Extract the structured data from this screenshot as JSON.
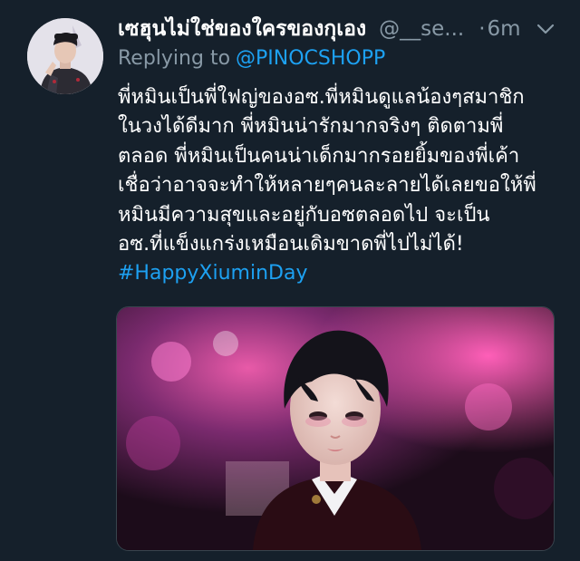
{
  "tweet": {
    "display_name": "เซฮุนไม่ใช่ของใครของกุเอง",
    "handle": "@__se...",
    "separator": "·",
    "time": "6m",
    "replying_prefix": "Replying to",
    "replying_to": "@PINOCSHOPP",
    "body_lines": [
      "พี่หมินเป็นพี่ใฟญ่ของอซ.พี่หมินดูแลน้องๆสมาชิก",
      "ในวงได้ดีมาก พี่หมินน่ารักมากจริงๆ ติดตามพี่",
      "ตลอด พี่หมินเป็นคนน่าเด็กมากรอยยิ้มของพี่เค้า",
      "เชื่อว่าอาจจะทำให้หลายๆคนละลายได้เลยขอให้พี่",
      "หมินมีความสุขและอยู่กับอซตลอดไป จะเป็น",
      "อซ.ที่แข็งแกร่งเหมือนเดิมขาดพี่ไปไม่ได้!"
    ],
    "hashtag": "#HappyXiuminDay",
    "avatar_icon": "profile-photo",
    "menu_icon": "chevron-down-icon",
    "media_alt": "photo"
  },
  "colors": {
    "background": "#15202b",
    "text_primary": "#ffffff",
    "text_secondary": "#8899a6",
    "accent": "#1da1f2"
  }
}
